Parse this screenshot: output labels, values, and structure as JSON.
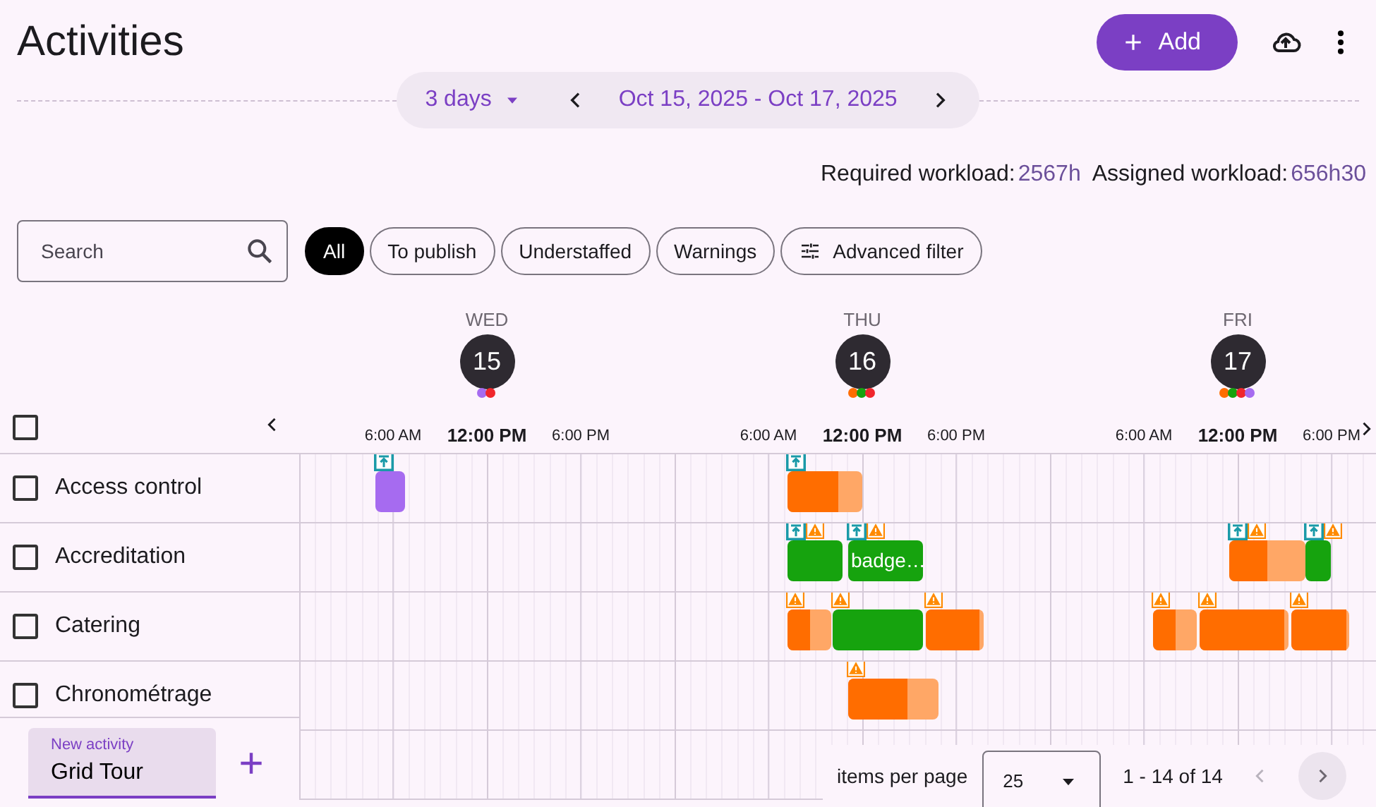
{
  "page": {
    "title": "Activities",
    "add_button": "Add"
  },
  "date_nav": {
    "range_select": "3 days",
    "range": "Oct 15, 2025 - Oct 17, 2025"
  },
  "workload": [
    {
      "label": "Required workload:",
      "value": "2567h"
    },
    {
      "label": "Assigned workload:",
      "value": "656h30"
    }
  ],
  "search": {
    "placeholder": "Search"
  },
  "filters": [
    {
      "label": "All",
      "selected": true,
      "kind": "plain"
    },
    {
      "label": "To publish",
      "selected": false,
      "kind": "plain"
    },
    {
      "label": "Understaffed",
      "selected": false,
      "kind": "plain"
    },
    {
      "label": "Warnings",
      "selected": false,
      "kind": "plain"
    },
    {
      "label": "Advanced filter",
      "selected": false,
      "kind": "advanced"
    }
  ],
  "days": [
    {
      "weekday": "WED",
      "date": "15",
      "dots": [
        {
          "color": "#a66bf0"
        },
        {
          "color": "#f0262c"
        }
      ],
      "times": [
        {
          "text": "6:00 AM",
          "major": false
        },
        {
          "text": "12:00 PM",
          "major": true
        },
        {
          "text": "6:00 PM",
          "major": false
        }
      ]
    },
    {
      "weekday": "THU",
      "date": "16",
      "dots": [
        {
          "color": "#ff6d00"
        },
        {
          "color": "#16a30e"
        },
        {
          "color": "#f0262c"
        }
      ],
      "times": [
        {
          "text": "6:00 AM",
          "major": false
        },
        {
          "text": "12:00 PM",
          "major": true
        },
        {
          "text": "6:00 PM",
          "major": false
        }
      ]
    },
    {
      "weekday": "FRI",
      "date": "17",
      "dots": [
        {
          "color": "#ff6d00"
        },
        {
          "color": "#16a30e"
        },
        {
          "color": "#f0262c"
        },
        {
          "color": "#a66bf0"
        }
      ],
      "times": [
        {
          "text": "6:00 AM",
          "major": false
        },
        {
          "text": "12:00 PM",
          "major": true
        },
        {
          "text": "6:00 PM",
          "major": false
        }
      ]
    }
  ],
  "select_all": {
    "checked": false
  },
  "rows": [
    {
      "name": "Access control",
      "checked": false,
      "bars": [
        {
          "color": "#a66bf0",
          "icons": [
            {
              "kind": "publish"
            }
          ]
        },
        {
          "color": "#ff6d00",
          "level": 0.68,
          "icons": [
            {
              "kind": "publish"
            }
          ]
        }
      ]
    },
    {
      "name": "Accreditation",
      "checked": false,
      "bars": [
        {
          "color": "#16a30e",
          "icons": [
            {
              "kind": "publish"
            },
            {
              "kind": "warning"
            }
          ]
        },
        {
          "color": "#16a30e",
          "icons": [
            {
              "kind": "publish"
            },
            {
              "kind": "warning"
            }
          ],
          "label": "badge…"
        },
        {
          "color": "#ff6d00",
          "level": 0.5,
          "icons": [
            {
              "kind": "publish"
            },
            {
              "kind": "warning"
            }
          ]
        },
        {
          "color": "#16a30e",
          "icons": [
            {
              "kind": "publish"
            },
            {
              "kind": "warning"
            }
          ]
        }
      ]
    },
    {
      "name": "Catering",
      "checked": false,
      "bars": [
        {
          "color": "#ff6d00",
          "level": 0.5,
          "icons": [
            {
              "kind": "warning"
            }
          ]
        },
        {
          "color": "#16a30e",
          "icons": [
            {
              "kind": "warning"
            }
          ]
        },
        {
          "color": "#ff6d00",
          "level": 0.92,
          "icons": [
            {
              "kind": "warning"
            }
          ]
        },
        {
          "color": "#ff6d00",
          "level": 0.5,
          "icons": [
            {
              "kind": "warning"
            }
          ]
        },
        {
          "color": "#ff6d00",
          "level": 0.95,
          "icons": [
            {
              "kind": "warning"
            }
          ]
        },
        {
          "color": "#ff6d00",
          "level": 0.95,
          "icons": [
            {
              "kind": "warning"
            }
          ]
        }
      ]
    },
    {
      "name": "Chronométrage",
      "checked": false,
      "bars": [
        {
          "color": "#ff6d00",
          "level": 0.66,
          "icons": [
            {
              "kind": "warning"
            }
          ]
        }
      ]
    }
  ],
  "new_activity": {
    "label": "New activity",
    "value": "Grid Tour"
  },
  "pagination": {
    "label": "items per page",
    "page_size": "25",
    "range": "1 - 14 of 14",
    "prev_disabled": true,
    "next_disabled": false
  }
}
